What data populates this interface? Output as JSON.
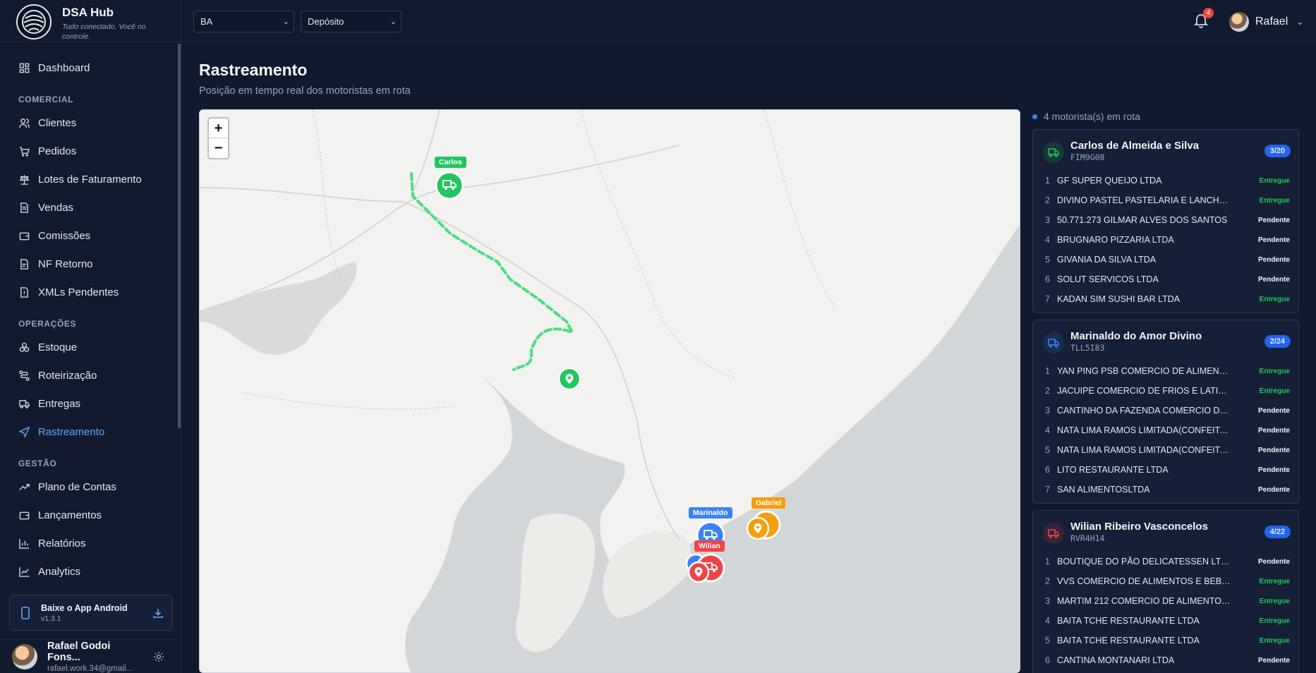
{
  "brand": {
    "title": "DSA Hub",
    "subtitle": "Tudo conectado. Você no controle."
  },
  "topbar": {
    "state_select": "BA",
    "warehouse_select": "Depósito",
    "notifications": "4",
    "user_name": "Rafael"
  },
  "nav": {
    "dashboard": "Dashboard",
    "sections": {
      "comercial": "COMERCIAL",
      "operacoes": "OPERAÇÕES",
      "gestao": "GESTÃO"
    },
    "comercial": [
      "Clientes",
      "Pedidos",
      "Lotes de Faturamento",
      "Vendas",
      "Comissões",
      "NF Retorno",
      "XMLs Pendentes"
    ],
    "operacoes": [
      "Estoque",
      "Roteirização",
      "Entregas",
      "Rastreamento"
    ],
    "gestao": [
      "Plano de Contas",
      "Lançamentos",
      "Relatórios",
      "Analytics"
    ]
  },
  "app_card": {
    "title": "Baixe o App Android",
    "version": "v1.3.1"
  },
  "user_footer": {
    "name": "Rafael Godoi Fons...",
    "email": "rafael.work.34@gmail..."
  },
  "page": {
    "title": "Rastreamento",
    "subtitle": "Posição em tempo real dos motoristas em rota"
  },
  "map": {
    "zoom_in": "+",
    "zoom_out": "−",
    "labels": {
      "carlos": "Carlos",
      "marinaldo": "Marinaldo",
      "wilian": "Wilian",
      "gabriel": "Gabriel"
    },
    "colors": {
      "green": "#22c55e",
      "blue": "#3b82f6",
      "red": "#ef4444",
      "orange": "#f59e0b"
    }
  },
  "panel": {
    "header": "4 motorista(s) em rota",
    "drivers": [
      {
        "name": "Carlos de Almeida e Silva",
        "plate": "FIM9G08",
        "count": "3/20",
        "color": "#22c55e",
        "stops": [
          {
            "n": "1",
            "name": "GF SUPER QUEIJO LTDA",
            "status": "Entregue"
          },
          {
            "n": "2",
            "name": "DIVINO PASTEL PASTELARIA E LANCHONE...",
            "status": "Entregue"
          },
          {
            "n": "3",
            "name": "50.771.273 GILMAR ALVES DOS SANTOS",
            "status": "Pendente"
          },
          {
            "n": "4",
            "name": "BRUGNARO PIZZARIA LTDA",
            "status": "Pendente"
          },
          {
            "n": "5",
            "name": "GIVANIA DA SILVA LTDA",
            "status": "Pendente"
          },
          {
            "n": "6",
            "name": "SOLUT SERVICOS LTDA",
            "status": "Pendente"
          },
          {
            "n": "7",
            "name": "KADAN SIM SUSHI BAR LTDA",
            "status": "Entregue"
          }
        ]
      },
      {
        "name": "Marinaldo do Amor Divino",
        "plate": "TLL5I83",
        "count": "2/24",
        "color": "#3b82f6",
        "stops": [
          {
            "n": "1",
            "name": "YAN PING PSB COMERCIO DE ALIMENTOS ...",
            "status": "Entregue"
          },
          {
            "n": "2",
            "name": "JACUIPE COMERCIO DE FRIOS E LATICINIO...",
            "status": "Entregue"
          },
          {
            "n": "3",
            "name": "CANTINHO DA FAZENDA COMERCIO DE AL...",
            "status": "Pendente"
          },
          {
            "n": "4",
            "name": "NATA LIMA RAMOS LIMITADA(CONFEITARI...",
            "status": "Pendente"
          },
          {
            "n": "5",
            "name": "NATA LIMA RAMOS LIMITADA(CONFEITARI...",
            "status": "Pendente"
          },
          {
            "n": "6",
            "name": "LITO RESTAURANTE LTDA",
            "status": "Pendente"
          },
          {
            "n": "7",
            "name": "SAN ALIMENTOSLTDA",
            "status": "Pendente"
          }
        ]
      },
      {
        "name": "Wilian Ribeiro Vasconcelos",
        "plate": "RVR4H14",
        "count": "4/22",
        "color": "#ef4444",
        "stops": [
          {
            "n": "1",
            "name": "BOUTIQUE DO PÃO DELICATESSEN LTDA-...",
            "status": "Pendente"
          },
          {
            "n": "2",
            "name": "VVS COMERCIO DE ALIMENTOS E BEBIDAS...",
            "status": "Entregue"
          },
          {
            "n": "3",
            "name": "MARTIM 212 COMERCIO DE ALIMENTOS LT...",
            "status": "Entregue"
          },
          {
            "n": "4",
            "name": "BAITA TCHE RESTAURANTE LTDA",
            "status": "Entregue"
          },
          {
            "n": "5",
            "name": "BAITA TCHE RESTAURANTE LTDA",
            "status": "Entregue"
          },
          {
            "n": "6",
            "name": "CANTINA MONTANARI LTDA",
            "status": "Pendente"
          }
        ]
      }
    ]
  }
}
